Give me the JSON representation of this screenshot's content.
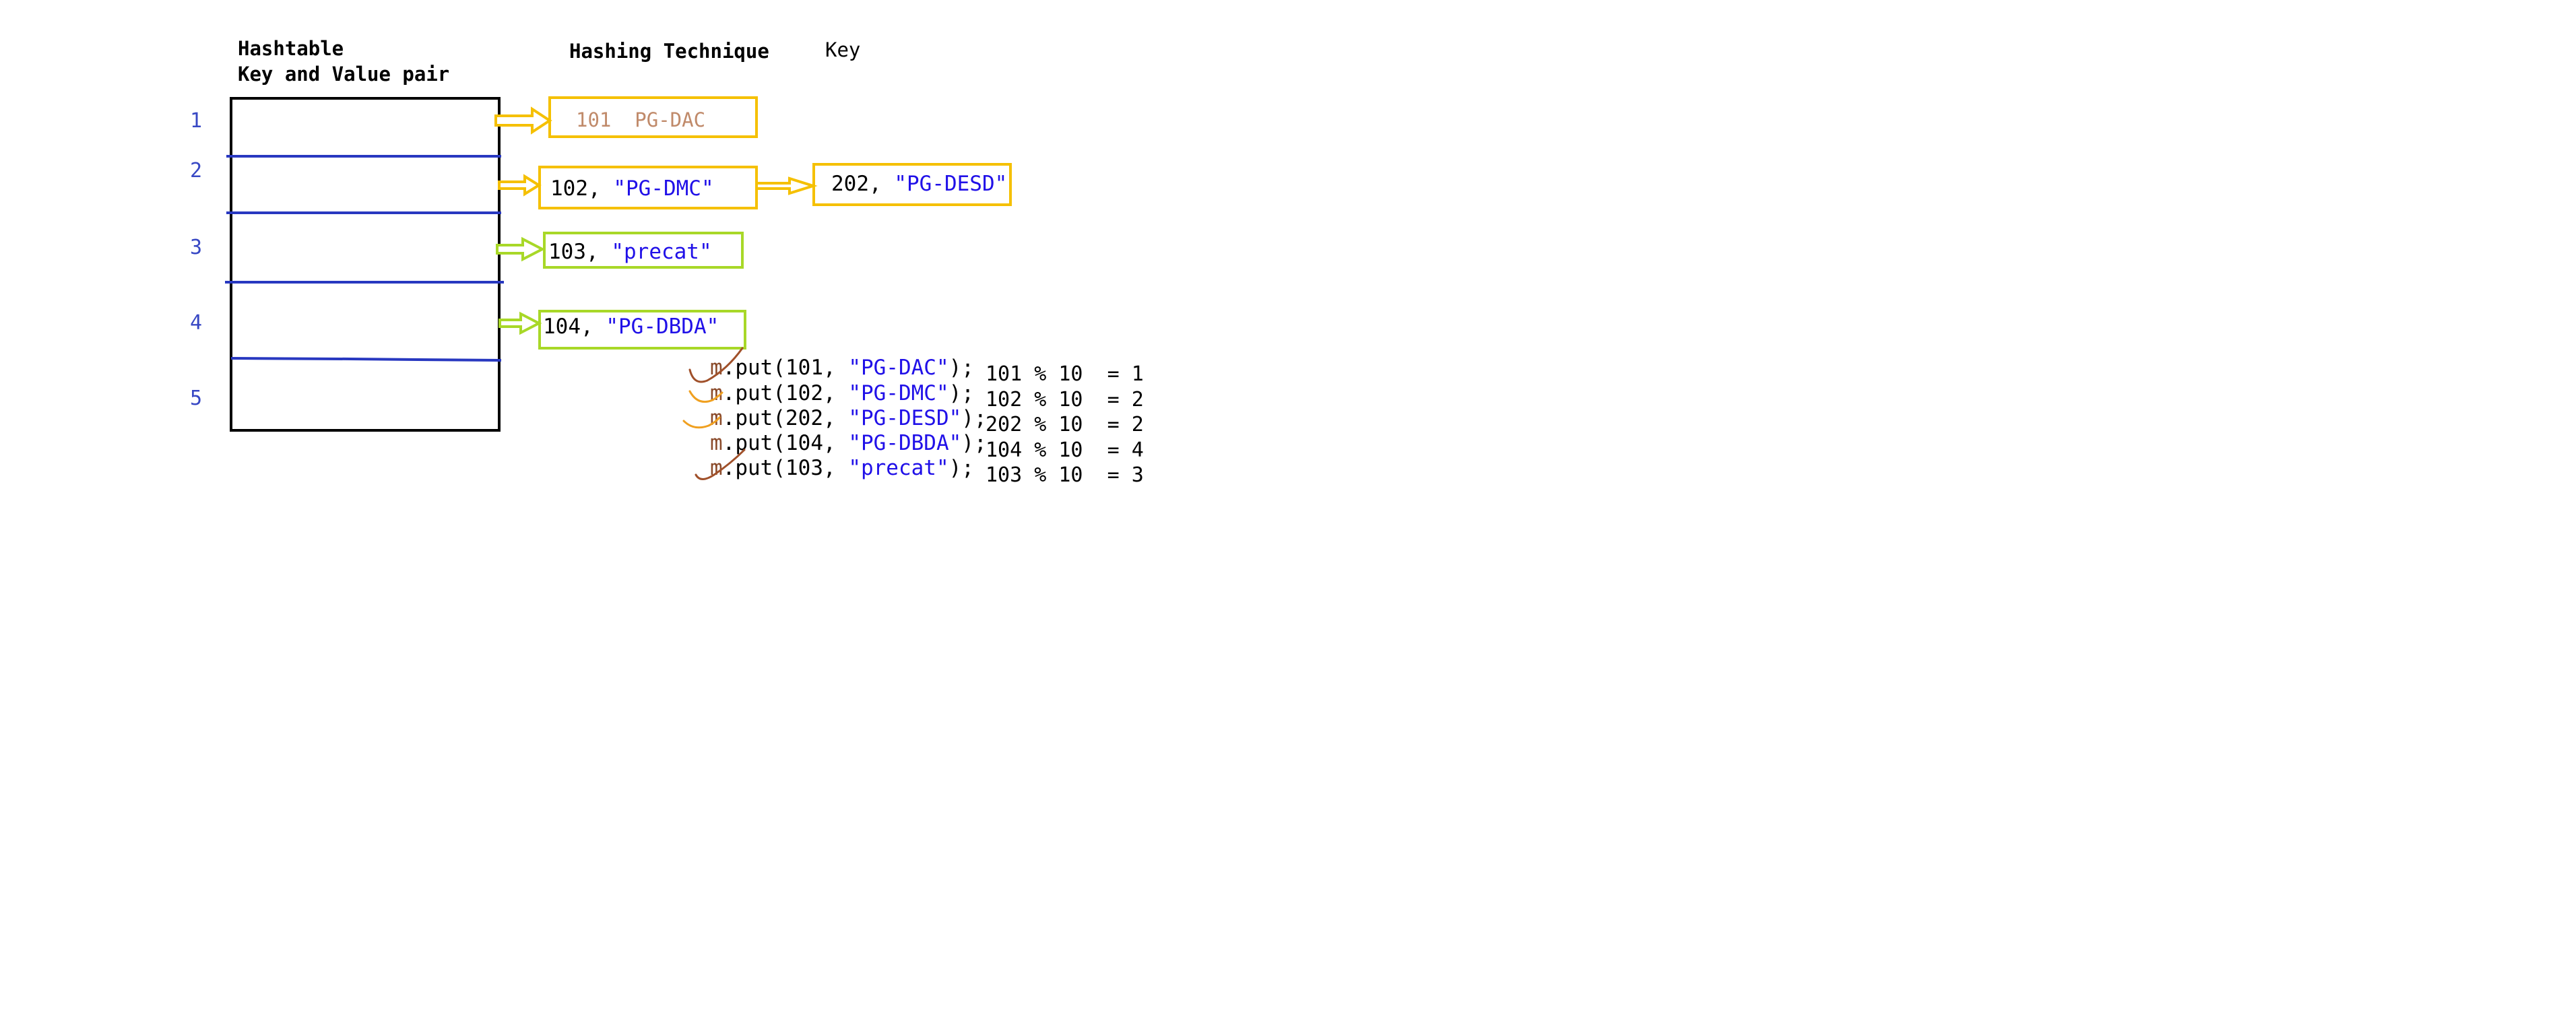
{
  "headings": {
    "hashtable_line1": "Hashtable",
    "hashtable_line2": "Key and Value pair",
    "technique": "Hashing Technique",
    "key": "Key"
  },
  "buckets": [
    "1",
    "2",
    "3",
    "4",
    "5"
  ],
  "entries": [
    {
      "key": "101",
      "value": "PG-DAC",
      "text": "101  PG-DAC",
      "color": "#f5c000"
    },
    {
      "key": "102",
      "text_key": "102, ",
      "text_val": "\"PG-DMC\"",
      "color": "#f5c000"
    },
    {
      "key": "202",
      "text_key": "202, ",
      "text_val": "\"PG-DESD\"",
      "color": "#f5c000"
    },
    {
      "key": "103",
      "text_key": "103, ",
      "text_val": "\"precat\"",
      "color": "#a8d828"
    },
    {
      "key": "104",
      "text_key": "104, ",
      "text_val": "\"PG-DBDA\"",
      "color": "#a8d828"
    }
  ],
  "code": [
    {
      "var": "m",
      "pre": ".put(101, ",
      "str": "\"PG-DAC\"",
      "post": ");"
    },
    {
      "var": "m",
      "pre": ".put(102, ",
      "str": "\"PG-DMC\"",
      "post": ");"
    },
    {
      "var": "m",
      "pre": ".put(202, ",
      "str": "\"PG-DESD\"",
      "post": ");"
    },
    {
      "var": "m",
      "pre": ".put(104, ",
      "str": "\"PG-DBDA\"",
      "post": ");"
    },
    {
      "var": "m",
      "pre": ".put(103, ",
      "str": "\"precat\"",
      "post": ");"
    }
  ],
  "calculations": [
    "101 % 10  = 1",
    "102 % 10  = 2",
    "202 % 10  = 2",
    "104 % 10  = 4",
    "103 % 10  = 3"
  ],
  "colors": {
    "table_border": "#000000",
    "divider": "#2838c0",
    "yellow": "#f5c000",
    "green": "#a8d828",
    "check_brown": "#a0502a",
    "check_orange": "#f0a020"
  }
}
